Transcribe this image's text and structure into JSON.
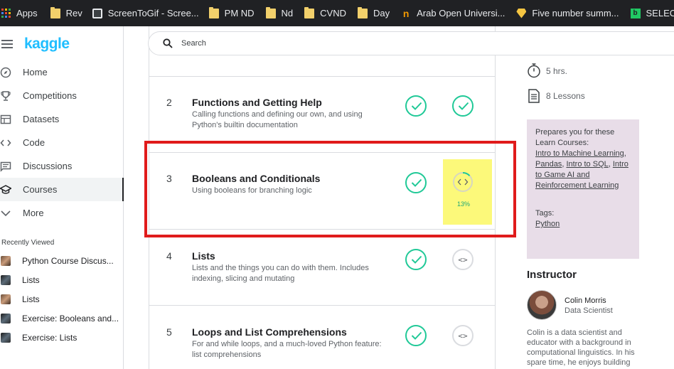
{
  "bookmarks": [
    {
      "label": "Apps",
      "icon": "apps-grid-icon"
    },
    {
      "label": "Rev",
      "icon": "folder-icon"
    },
    {
      "label": "ScreenToGif - Scree...",
      "icon": "screen-icon"
    },
    {
      "label": "PM ND",
      "icon": "folder-icon"
    },
    {
      "label": "Nd",
      "icon": "folder-icon"
    },
    {
      "label": "CVND",
      "icon": "folder-icon"
    },
    {
      "label": "Day",
      "icon": "folder-icon"
    },
    {
      "label": "Arab Open Universi...",
      "icon": "arab-open-university-icon"
    },
    {
      "label": "Five number summ...",
      "icon": "gem-icon"
    },
    {
      "label": "SELECT DISTIN",
      "icon": "select-icon"
    }
  ],
  "brand": {
    "logo": "kaggle",
    "accent": "#20beff"
  },
  "nav": {
    "items": [
      {
        "label": "Home",
        "icon": "compass-icon"
      },
      {
        "label": "Competitions",
        "icon": "trophy-icon"
      },
      {
        "label": "Datasets",
        "icon": "table-icon"
      },
      {
        "label": "Code",
        "icon": "code-icon"
      },
      {
        "label": "Discussions",
        "icon": "comment-icon"
      },
      {
        "label": "Courses",
        "icon": "graduation-cap-icon"
      },
      {
        "label": "More",
        "icon": "chevron-down-icon"
      }
    ],
    "active": "Courses"
  },
  "recently_viewed": {
    "title": "Recently Viewed",
    "items": [
      "Python Course Discus...",
      "Lists",
      "Lists",
      "Exercise: Booleans and...",
      "Exercise: Lists"
    ]
  },
  "search": {
    "placeholder": "Search"
  },
  "lessons": [
    {
      "num": "2",
      "title": "Functions and Getting Help",
      "desc": "Calling functions and defining our own, and using Python's builtin documentation",
      "tutorial_done": true,
      "exercise_done": true,
      "progress": null
    },
    {
      "num": "3",
      "title": "Booleans and Conditionals",
      "desc": "Using booleans for branching logic",
      "tutorial_done": true,
      "exercise_done": false,
      "progress": "13%"
    },
    {
      "num": "4",
      "title": "Lists",
      "desc": "Lists and the things you can do with them. Includes indexing, slicing and mutating",
      "tutorial_done": true,
      "exercise_done": false,
      "progress": null
    },
    {
      "num": "5",
      "title": "Loops and List Comprehensions",
      "desc": "For and while loops, and a much-loved Python feature: list comprehensions",
      "tutorial_done": true,
      "exercise_done": false,
      "progress": null
    }
  ],
  "progress_fraction": 0.13,
  "colors": {
    "check": "#20c997",
    "highlight": "#fcf97a",
    "annotation": "#e01b1b",
    "card": "#e8dde8"
  },
  "course_meta": {
    "duration": "5 hrs.",
    "lessons": "8 Lessons"
  },
  "prepares": {
    "intro": "Prepares you for these Learn Courses:",
    "links": [
      "Intro to Machine Learning",
      "Pandas",
      "Intro to SQL",
      "Intro to Game AI and Reinforcement Learning"
    ],
    "tags_label": "Tags:",
    "tag": "Python"
  },
  "instructor": {
    "heading": "Instructor",
    "name": "Colin Morris",
    "role": "Data Scientist",
    "bio": "Colin is a data scientist and educator with a background in computational linguistics. In his spare time, he enjoys building"
  }
}
